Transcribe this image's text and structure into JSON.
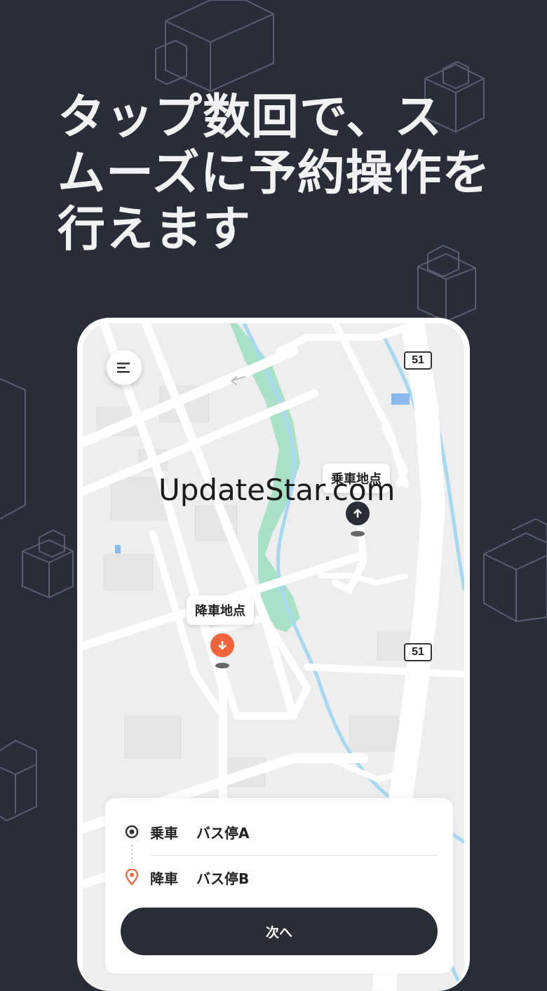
{
  "headline": {
    "line1": "タップ数回で、ス",
    "line2": "ムーズに予約操作を",
    "line3": "行えます"
  },
  "map": {
    "route_number_top": "51",
    "route_number_bottom": "51",
    "pickup_label": "乗車地点",
    "dropoff_label": "降車地点"
  },
  "watermark": "UpdateStar.com",
  "sheet": {
    "pickup_type": "乗車",
    "pickup_place": "バス停A",
    "dropoff_type": "降車",
    "dropoff_place": "バス停B",
    "next_label": "次へ"
  },
  "colors": {
    "background": "#2a2d38",
    "accent_dropoff": "#f0643c",
    "pin_pickup": "#2b2d36",
    "river": "#a8d8f0",
    "park": "#a8e0c8"
  }
}
